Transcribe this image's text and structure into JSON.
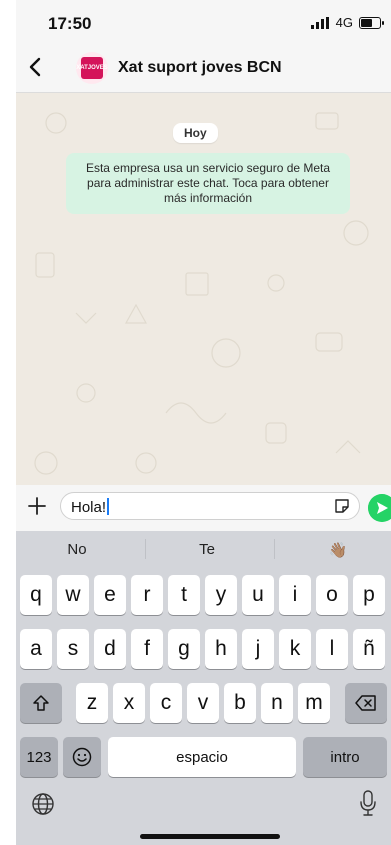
{
  "status": {
    "time": "17:50",
    "network": "4G"
  },
  "header": {
    "title": "Xat suport joves BCN",
    "logo_lines": [
      "XAT",
      "JOVES"
    ]
  },
  "chat": {
    "date_label": "Hoy",
    "notice": "Esta empresa usa un servicio seguro de Meta para administrar este chat. Toca para obtener más información"
  },
  "composer": {
    "text": "Hola!"
  },
  "keyboard": {
    "suggestions": [
      "No",
      "Te",
      "👋🏽"
    ],
    "row1": [
      "q",
      "w",
      "e",
      "r",
      "t",
      "y",
      "u",
      "i",
      "o",
      "p"
    ],
    "row2": [
      "a",
      "s",
      "d",
      "f",
      "g",
      "h",
      "j",
      "k",
      "l",
      "ñ"
    ],
    "row3": [
      "z",
      "x",
      "c",
      "v",
      "b",
      "n",
      "m"
    ],
    "numbers_label": "123",
    "space_label": "espacio",
    "return_label": "intro"
  },
  "colors": {
    "accent": "#25d366",
    "notice_bg": "#d7f3e3",
    "chat_bg": "#efeae2",
    "logo": "#d4145a"
  }
}
